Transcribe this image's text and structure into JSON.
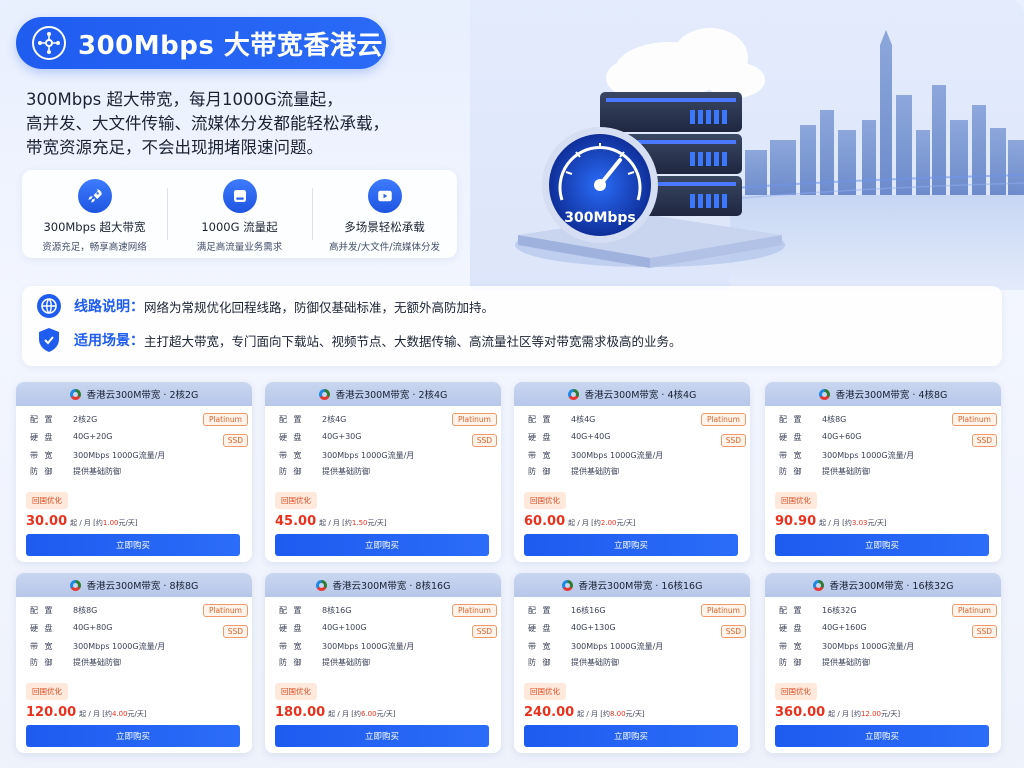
{
  "header": {
    "title": "300Mbps 大带宽香港云",
    "intro_lines": [
      "300Mbps 超大带宽，每月1000G流量起，",
      "高并发、大文件传输、流媒体分发都能轻松承载，",
      "带宽资源充足，不会出现拥堵限速问题。"
    ]
  },
  "features": [
    {
      "icon": "rocket-icon",
      "title": "300Mbps 超大带宽",
      "subtitle": "资源充足，畅享高速网络"
    },
    {
      "icon": "disk-icon",
      "title": "1000G 流量起",
      "subtitle": "满足高流量业务需求"
    },
    {
      "icon": "play-icon",
      "title": "多场景轻松承载",
      "subtitle": "高并发/大文件/流媒体分发"
    }
  ],
  "hero": {
    "gauge_label": "300Mbps"
  },
  "info": {
    "line_key": "线路说明：",
    "line_text": "网络为常规优化回程线路，防御仅基础标准，无额外高防加持。",
    "scene_key": "适用场景：",
    "scene_text": "主打超大带宽，专门面向下载站、视频节点、大数据传输、高流量社区等对带宽需求极高的业务。"
  },
  "spec_labels": {
    "config": "配 置",
    "disk": "硬 盘",
    "bandwidth": "带 宽",
    "defense": "防 御"
  },
  "labels": {
    "platinum": "Platinum",
    "ssd": "SSD",
    "tag": "回国优化",
    "price_unit": "起 / 月",
    "daily_prefix": "[约",
    "daily_suffix": "元/天]",
    "buy": "立即购买"
  },
  "colors": {
    "accent": "#1f5cf0",
    "price": "#e8321e",
    "badge": "#e0632a"
  },
  "products": [
    {
      "name": "香港云300M带宽 · 2核2G",
      "config": "2核2G",
      "disk": "40G+20G",
      "bandwidth": "300Mbps 1000G流量/月",
      "defense": "提供基础防御",
      "price": "30.00",
      "daily": "1.00"
    },
    {
      "name": "香港云300M带宽 · 2核4G",
      "config": "2核4G",
      "disk": "40G+30G",
      "bandwidth": "300Mbps 1000G流量/月",
      "defense": "提供基础防御",
      "price": "45.00",
      "daily": "1.50"
    },
    {
      "name": "香港云300M带宽 · 4核4G",
      "config": "4核4G",
      "disk": "40G+40G",
      "bandwidth": "300Mbps 1000G流量/月",
      "defense": "提供基础防御",
      "price": "60.00",
      "daily": "2.00"
    },
    {
      "name": "香港云300M带宽 · 4核8G",
      "config": "4核8G",
      "disk": "40G+60G",
      "bandwidth": "300Mbps 1000G流量/月",
      "defense": "提供基础防御",
      "price": "90.90",
      "daily": "3.03"
    },
    {
      "name": "香港云300M带宽 · 8核8G",
      "config": "8核8G",
      "disk": "40G+80G",
      "bandwidth": "300Mbps 1000G流量/月",
      "defense": "提供基础防御",
      "price": "120.00",
      "daily": "4.00"
    },
    {
      "name": "香港云300M带宽 · 8核16G",
      "config": "8核16G",
      "disk": "40G+100G",
      "bandwidth": "300Mbps 1000G流量/月",
      "defense": "提供基础防御",
      "price": "180.00",
      "daily": "6.00"
    },
    {
      "name": "香港云300M带宽 · 16核16G",
      "config": "16核16G",
      "disk": "40G+130G",
      "bandwidth": "300Mbps 1000G流量/月",
      "defense": "提供基础防御",
      "price": "240.00",
      "daily": "8.00"
    },
    {
      "name": "香港云300M带宽 · 16核32G",
      "config": "16核32G",
      "disk": "40G+160G",
      "bandwidth": "300Mbps 1000G流量/月",
      "defense": "提供基础防御",
      "price": "360.00",
      "daily": "12.00"
    }
  ]
}
